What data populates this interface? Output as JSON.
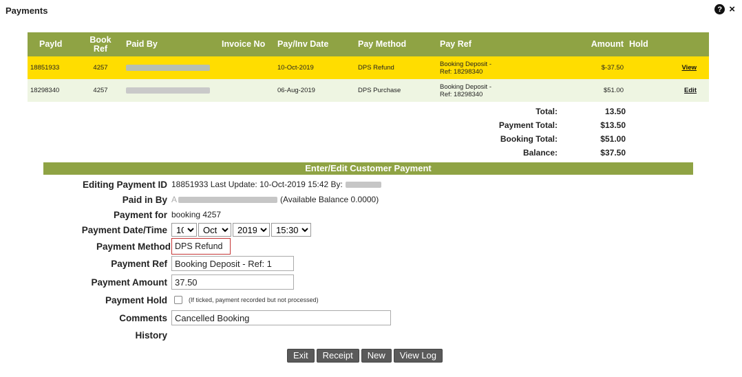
{
  "dialog": {
    "title": "Payments",
    "help_icon": "?",
    "close_icon": "×"
  },
  "table": {
    "headers": [
      "PayId",
      "Book Ref",
      "Paid By",
      "Invoice No",
      "Pay/Inv Date",
      "Pay Method",
      "Pay Ref",
      "Amount",
      "Hold",
      ""
    ],
    "rows": [
      {
        "pay_id": "18851933",
        "book_ref": "4257",
        "paid_by": "",
        "invoice_no": "",
        "date": "10-Oct-2019",
        "method": "DPS Refund",
        "pay_ref_1": "Booking Deposit -",
        "pay_ref_2": "Ref: 18298340",
        "amount": "$-37.50",
        "hold": "",
        "action": "View"
      },
      {
        "pay_id": "18298340",
        "book_ref": "4257",
        "paid_by": "",
        "invoice_no": "",
        "date": "06-Aug-2019",
        "method": "DPS Purchase",
        "pay_ref_1": "Booking Deposit -",
        "pay_ref_2": "Ref: 18298340",
        "amount": "$51.00",
        "hold": "",
        "action": "Edit"
      }
    ]
  },
  "totals": [
    {
      "label": "Total:",
      "value": "13.50"
    },
    {
      "label": "Payment Total:",
      "value": "$13.50"
    },
    {
      "label": "Booking Total:",
      "value": "$51.00"
    },
    {
      "label": "Balance:",
      "value": "$37.50"
    }
  ],
  "form": {
    "section_title": "Enter/Edit Customer Payment",
    "editing_label": "Editing Payment ID",
    "editing_value": "18851933 Last Update: 10-Oct-2019 15:42 By:",
    "paid_in_by_label": "Paid in By",
    "paid_in_by_prefix": "A",
    "paid_in_by_suffix": "(Available Balance 0.0000)",
    "payment_for_label": "Payment for",
    "payment_for_value": "booking 4257",
    "date_time_label": "Payment Date/Time",
    "day": "10",
    "month": "Oct",
    "year": "2019",
    "time": "15:30",
    "method_label": "Payment Method",
    "method_value": "DPS Refund",
    "ref_label": "Payment Ref",
    "ref_value": "Booking Deposit - Ref: 1",
    "amount_label": "Payment Amount",
    "amount_value": "37.50",
    "hold_label": "Payment Hold",
    "hold_note": "(If ticked, payment recorded but not processed)",
    "comments_label": "Comments",
    "comments_value": "Cancelled Booking",
    "history_label": "History"
  },
  "buttons": {
    "exit": "Exit",
    "receipt": "Receipt",
    "new": "New",
    "view_log": "View Log"
  }
}
